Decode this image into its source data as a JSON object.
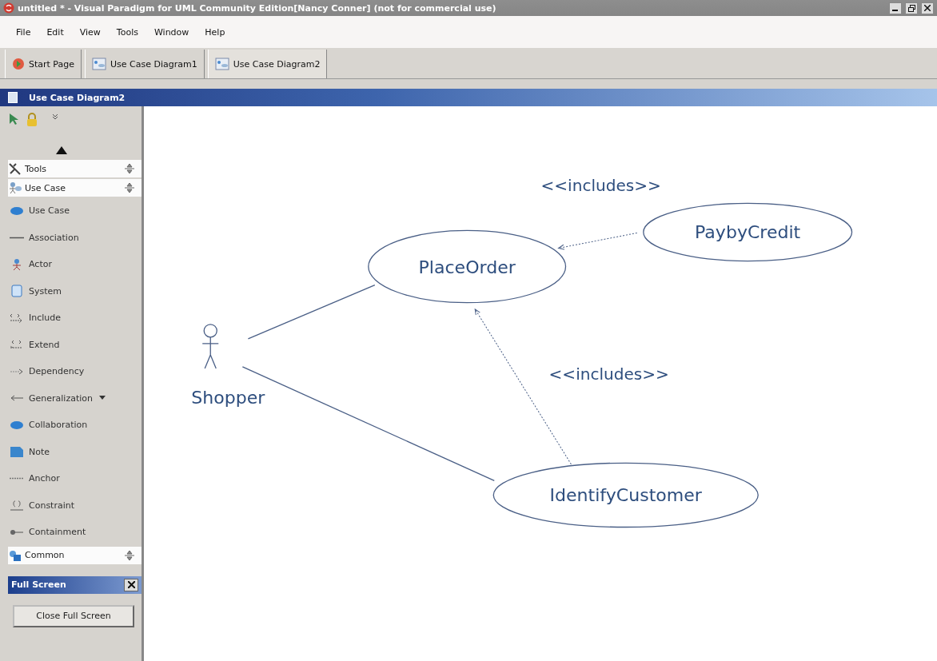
{
  "window": {
    "title": "untitled * - Visual Paradigm for UML Community Edition[Nancy Conner] (not for commercial use)"
  },
  "menu": [
    "File",
    "Edit",
    "View",
    "Tools",
    "Window",
    "Help"
  ],
  "tabs": [
    {
      "label": "Start Page",
      "selected": false
    },
    {
      "label": "Use Case Diagram1",
      "selected": false
    },
    {
      "label": "Use Case Diagram2",
      "selected": true
    }
  ],
  "diagram_title": "Use Case Diagram2",
  "palette": [
    {
      "kind": "section",
      "label": "Tools"
    },
    {
      "kind": "section",
      "label": "Use Case"
    },
    {
      "kind": "tool",
      "label": "Use Case"
    },
    {
      "kind": "tool",
      "label": "Association"
    },
    {
      "kind": "tool",
      "label": "Actor"
    },
    {
      "kind": "tool",
      "label": "System"
    },
    {
      "kind": "tool",
      "label": "Include"
    },
    {
      "kind": "tool",
      "label": "Extend"
    },
    {
      "kind": "tool",
      "label": "Dependency"
    },
    {
      "kind": "tool",
      "label": "Generalization",
      "has_menu": true
    },
    {
      "kind": "tool",
      "label": "Collaboration"
    },
    {
      "kind": "tool",
      "label": "Note"
    },
    {
      "kind": "tool",
      "label": "Anchor"
    },
    {
      "kind": "tool",
      "label": "Constraint"
    },
    {
      "kind": "tool",
      "label": "Containment"
    },
    {
      "kind": "section",
      "label": "Common"
    }
  ],
  "full_screen": {
    "title": "Full Screen",
    "button": "Close Full Screen"
  },
  "diagram": {
    "actors": [
      {
        "name": "Shopper"
      }
    ],
    "use_cases": [
      {
        "name": "PlaceOrder"
      },
      {
        "name": "PaybyCredit"
      },
      {
        "name": "IdentifyCustomer"
      }
    ],
    "includes_labels": [
      "<<includes>>",
      "<<includes>>"
    ]
  }
}
